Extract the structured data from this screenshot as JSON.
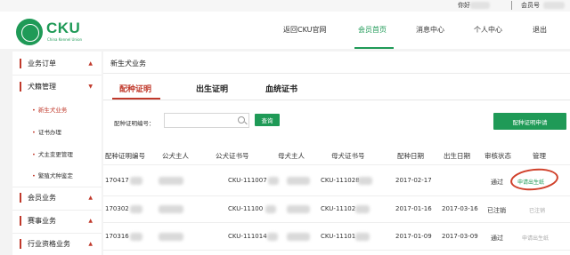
{
  "topbar": {
    "greeting": "你好",
    "member_label": "会员号"
  },
  "brand": {
    "name": "CKU",
    "sub": "China Kennel Union"
  },
  "nav": [
    {
      "label": "返回CKU官网",
      "active": false
    },
    {
      "label": "会员首页",
      "active": true
    },
    {
      "label": "消息中心",
      "active": false
    },
    {
      "label": "个人中心",
      "active": false
    },
    {
      "label": "退出",
      "active": false
    }
  ],
  "sidebar": {
    "sections": [
      {
        "label": "业务订单",
        "arrow": "▲"
      },
      {
        "label": "犬籍管理",
        "arrow": "▼"
      },
      {
        "label": "会员业务",
        "arrow": "▲"
      },
      {
        "label": "赛事业务",
        "arrow": "▲"
      },
      {
        "label": "行业资格业务",
        "arrow": "▲"
      }
    ],
    "subitems": [
      {
        "label": "新生犬业务",
        "active": true
      },
      {
        "label": "证书办理",
        "active": false
      },
      {
        "label": "犬主变更管理",
        "active": false
      },
      {
        "label": "繁殖犬种鉴定",
        "active": false
      }
    ]
  },
  "main": {
    "title": "新生犬业务",
    "tabs": [
      "配种证明",
      "出生证明",
      "血统证书"
    ],
    "search_label": "配种证明编号：",
    "search_placeholder": "",
    "query_button": "查询",
    "apply_button": "配种证明申请",
    "columns": [
      "配种证明编号",
      "公犬主人",
      "公犬证书号",
      "母犬主人",
      "母犬证书号",
      "配种日期",
      "出生日期",
      "审核状态",
      "管理"
    ],
    "rows": [
      {
        "id": "170417",
        "sire_cert": "CKU-111007",
        "dam_cert": "CKU-111028",
        "mating_date": "2017-02-17",
        "birth_date": "",
        "status": "通过",
        "action": "申请出生纸",
        "action_style": "link"
      },
      {
        "id": "170302",
        "sire_cert": "CKU-11100",
        "dam_cert": "CKU-11102",
        "mating_date": "2017-01-16",
        "birth_date": "2017-03-16",
        "status": "已注销",
        "action": "已注销",
        "action_style": "muted"
      },
      {
        "id": "170316",
        "sire_cert": "CKU-111014",
        "dam_cert": "CKU-11101",
        "mating_date": "2017-01-09",
        "birth_date": "2017-03-09",
        "status": "通过",
        "action": "申请出生纸",
        "action_style": "muted"
      }
    ]
  },
  "colors": {
    "brand_green": "#1f9a57",
    "accent_red": "#c0392b",
    "annotation_red": "#d0402a"
  }
}
